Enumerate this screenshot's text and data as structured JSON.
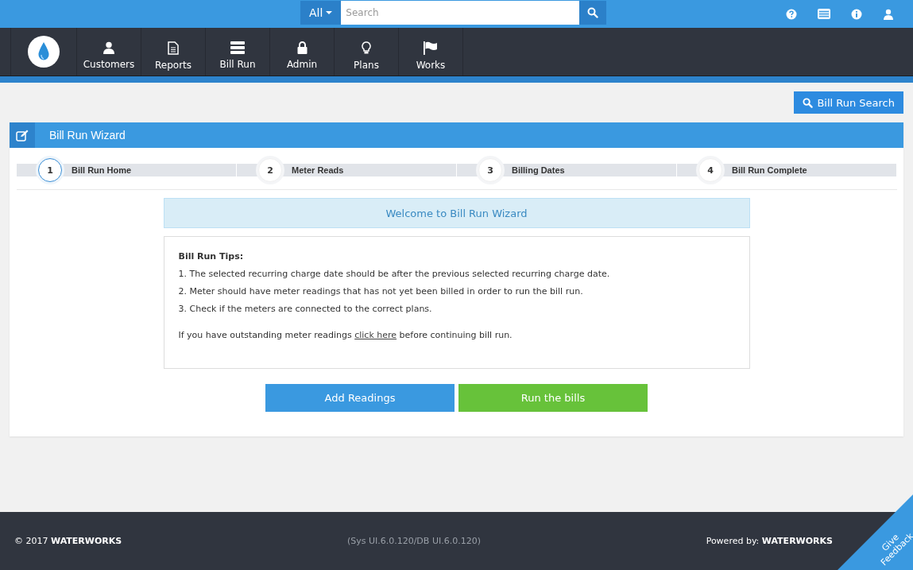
{
  "top_bar": {
    "scope": "All",
    "search": {
      "placeholder": "Search"
    }
  },
  "nav": {
    "items": [
      {
        "label": "Customers"
      },
      {
        "label": "Reports"
      },
      {
        "label": "Bill Run"
      },
      {
        "label": "Admin"
      },
      {
        "label": "Plans"
      },
      {
        "label": "Works"
      }
    ]
  },
  "toolbar": {
    "button": "Bill Run Search"
  },
  "panel": {
    "title": "Bill Run Wizard",
    "steps": [
      {
        "number": "1",
        "label": "Bill Run Home",
        "selected": true
      },
      {
        "number": "2",
        "label": "Meter Reads",
        "selected": false
      },
      {
        "number": "3",
        "label": "Billing Dates",
        "selected": false
      },
      {
        "number": "4",
        "label": "Bill Run Complete",
        "selected": false
      }
    ],
    "welcome": "Welcome to Bill Run Wizard",
    "tips_title": "Bill Run Tips:",
    "tips": [
      "1. The selected recurring charge date should be after the previous selected recurring charge date.",
      "2. Meter should have meter readings that has not yet been billed in order to run the bill run.",
      "3. Check if the meters are connected to the correct plans."
    ],
    "note": {
      "before": "If you have outstanding meter readings",
      "link": "click here",
      "after": "before continuing bill run."
    },
    "buttons": [
      {
        "label": "Add Readings",
        "kind": "primary"
      },
      {
        "label": "Run the bills",
        "kind": "success"
      }
    ]
  },
  "footer": {
    "copyright": "© 2017 **WATERWORKS**",
    "version": "(Sys UI.6.0.120/DB UI.6.0.120)",
    "powered": "Powered by: **WATERWORKS**",
    "feedback": [
      "Give",
      "Feedback"
    ]
  }
}
